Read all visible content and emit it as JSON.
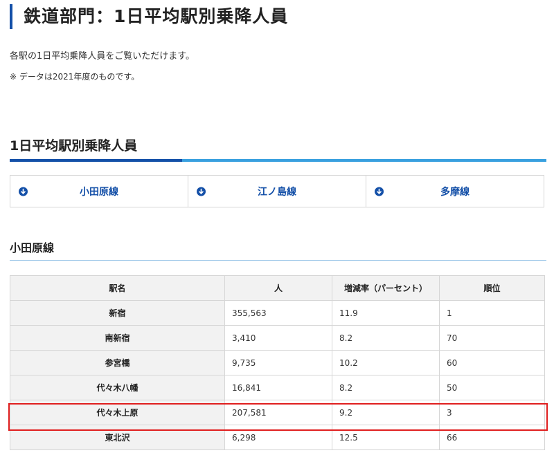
{
  "page": {
    "title": "鉄道部門：1日平均駅別乗降人員",
    "intro": "各駅の1日平均乗降人員をご覧いただけます。",
    "note": "※ データは2021年度のものです。"
  },
  "section": {
    "heading": "1日平均駅別乗降人員",
    "line_tabs": [
      {
        "label": "小田原線",
        "icon": "arrow-down-circle-icon"
      },
      {
        "label": "江ノ島線",
        "icon": "arrow-down-circle-icon"
      },
      {
        "label": "多摩線",
        "icon": "arrow-down-circle-icon"
      }
    ]
  },
  "odawara": {
    "heading": "小田原線",
    "columns": [
      "駅名",
      "人",
      "増減率（パーセント）",
      "順位"
    ],
    "rows": [
      {
        "station": "新宿",
        "people": "355,563",
        "rate": "11.9",
        "rank": "1"
      },
      {
        "station": "南新宿",
        "people": "3,410",
        "rate": "8.2",
        "rank": "70"
      },
      {
        "station": "参宮橋",
        "people": "9,735",
        "rate": "10.2",
        "rank": "60"
      },
      {
        "station": "代々木八幡",
        "people": "16,841",
        "rate": "8.2",
        "rank": "50"
      },
      {
        "station": "代々木上原",
        "people": "207,581",
        "rate": "9.2",
        "rank": "3",
        "highlighted": true
      },
      {
        "station": "東北沢",
        "people": "6,298",
        "rate": "12.5",
        "rank": "66"
      }
    ]
  },
  "colors": {
    "accent_dark": "#1450a8",
    "accent_light": "#39a0df",
    "highlight": "#e01e1e"
  }
}
